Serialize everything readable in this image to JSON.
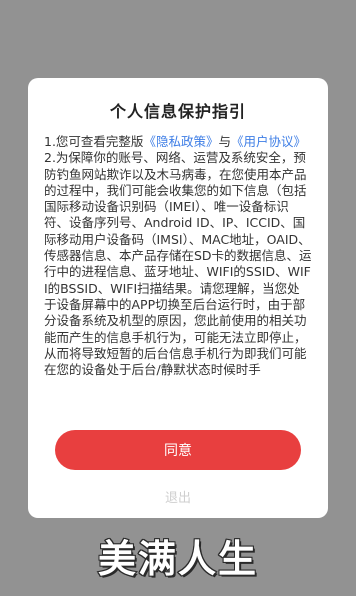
{
  "dialog": {
    "title": "个人信息保护指引",
    "clause1": {
      "prefix": "1.您可查看完整版",
      "privacy_link": "《隐私政策》",
      "conjunction": "与",
      "user_agreement_link": "《用户协议》"
    },
    "clause2": "2.为保障你的账号、网络、运营及系统安全，预防钓鱼网站欺诈以及木马病毒，在您使用本产品的过程中，我们可能会收集您的如下信息（包括国际移动设备识别码（IMEI）、唯一设备标识符、设备序列号、Android ID、IP、ICCID、国际移动用户设备码（IMSI）、MAC地址，OAID、传感器信息、本产品存储在SD卡的数据信息、运行中的进程信息、蓝牙地址、WIFI的SSID、WIFI的BSSID、WIFI扫描结果。请您理解，当您处于设备屏幕中的APP切换至后台运行时，由于部分设备系统及机型的原因，您此前使用的相关功能而产生的信息手机行为，可能无法立即停止，从而将导致短暂的后台信息手机行为即我们可能在您的设备处于后台/静默状态时候时手",
    "agree_label": "同意",
    "exit_label": "退出"
  },
  "watermark": "美满人生",
  "colors": {
    "agree_button": "#e83f3f",
    "link": "#3e7ee6",
    "overlay": "#929292"
  }
}
